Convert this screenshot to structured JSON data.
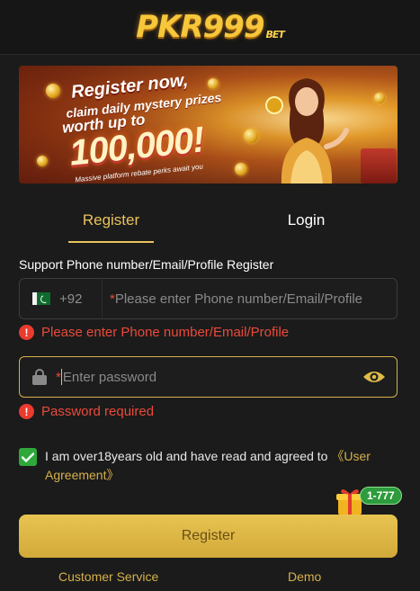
{
  "brand": {
    "logo_text": "PKR999",
    "logo_suffix": "BET",
    "accent": "#e9c25c"
  },
  "banner": {
    "line1": "Register now,",
    "line2": "claim daily mystery prizes",
    "line3": "worth up to",
    "amount": "100,000!",
    "sub": "Massive platform rebate perks await you"
  },
  "tabs": {
    "register": "Register",
    "login": "Login",
    "active": "register"
  },
  "form": {
    "section_label": "Support Phone number/Email/Profile Register",
    "country_code": "+92",
    "phone_placeholder": "Please enter Phone number/Email/Profile",
    "password_placeholder": "Enter password",
    "phone_error": "Please enter Phone number/Email/Profile",
    "password_error": "Password required",
    "required_mark": "*",
    "error_mark": "!"
  },
  "agreement": {
    "checked": true,
    "text": "I am over18years old and have read and agreed to",
    "link": "《User Agreement》"
  },
  "promo_badge": "1-777",
  "register_button": "Register",
  "footer": {
    "customer_service": "Customer Service",
    "demo": "Demo"
  },
  "colors": {
    "background": "#1b1b1b",
    "error": "#ea4a3a",
    "checkbox": "#2fa83a",
    "button": "#e0bc48"
  }
}
